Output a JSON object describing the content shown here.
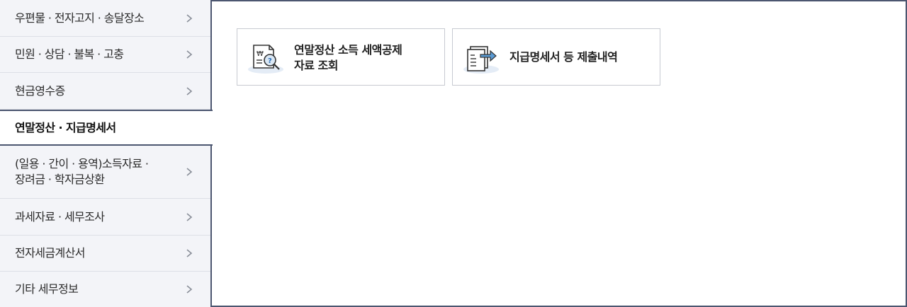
{
  "sidebar": {
    "items": [
      {
        "label": "우편물 · 전자고지 · 송달장소",
        "active": false
      },
      {
        "label": "민원 · 상담 · 불복 · 고충",
        "active": false
      },
      {
        "label": "현금영수증",
        "active": false
      },
      {
        "label": "연말정산 · 지급명세서",
        "active": true
      },
      {
        "label": "(일용 · 간이 · 용역)소득자료 ·\n장려금 · 학자금상환",
        "active": false
      },
      {
        "label": "과세자료 · 세무조사",
        "active": false
      },
      {
        "label": "전자세금계산서",
        "active": false
      },
      {
        "label": "기타 세무정보",
        "active": false
      }
    ]
  },
  "content": {
    "cards": [
      {
        "label": "연말정산 소득 세액공제\n자료 조회",
        "icon": "document-search-icon"
      },
      {
        "label": "지급명세서 등 제출내역",
        "icon": "document-submit-icon"
      }
    ]
  },
  "colors": {
    "active_border": "#4c5670",
    "sidebar_bg": "#f3f4f8",
    "icon_accent": "#5a9bd5"
  }
}
